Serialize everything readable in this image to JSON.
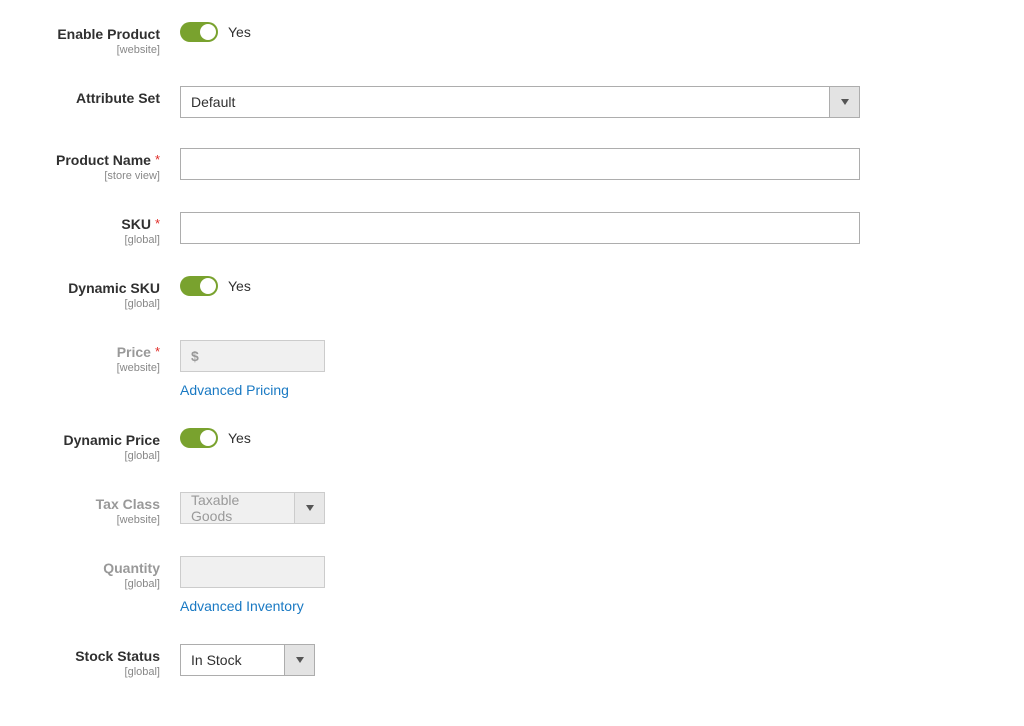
{
  "fields": {
    "enable_product": {
      "label": "Enable Product",
      "scope": "[website]",
      "toggle_text": "Yes"
    },
    "attribute_set": {
      "label": "Attribute Set",
      "value": "Default"
    },
    "product_name": {
      "label": "Product Name",
      "scope": "[store view]",
      "value": ""
    },
    "sku": {
      "label": "SKU",
      "scope": "[global]",
      "value": ""
    },
    "dynamic_sku": {
      "label": "Dynamic SKU",
      "scope": "[global]",
      "toggle_text": "Yes"
    },
    "price": {
      "label": "Price",
      "scope": "[website]",
      "currency": "$",
      "value": "",
      "link": "Advanced Pricing"
    },
    "dynamic_price": {
      "label": "Dynamic Price",
      "scope": "[global]",
      "toggle_text": "Yes"
    },
    "tax_class": {
      "label": "Tax Class",
      "scope": "[website]",
      "value": "Taxable Goods"
    },
    "quantity": {
      "label": "Quantity",
      "scope": "[global]",
      "value": "",
      "link": "Advanced Inventory"
    },
    "stock_status": {
      "label": "Stock Status",
      "scope": "[global]",
      "value": "In Stock"
    }
  }
}
